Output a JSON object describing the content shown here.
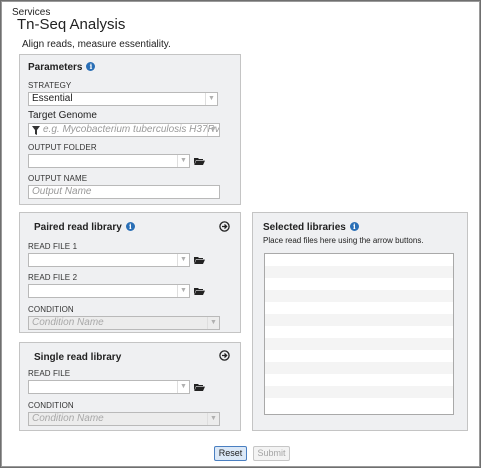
{
  "breadcrumb": "Services",
  "title": "Tn-Seq Analysis",
  "description": "Align reads, measure essentiality.",
  "parameters": {
    "title": "Parameters",
    "strategy_label": "STRATEGY",
    "strategy_value": "Essential",
    "genome_label": "Target Genome",
    "genome_placeholder": "e.g. Mycobacterium tuberculosis H37Rv",
    "output_folder_label": "OUTPUT FOLDER",
    "output_folder_value": "",
    "output_name_label": "OUTPUT NAME",
    "output_name_placeholder": "Output Name"
  },
  "paired": {
    "title": "Paired read library",
    "read1_label": "READ FILE 1",
    "read1_value": "",
    "read2_label": "READ FILE 2",
    "read2_value": "",
    "condition_label": "CONDITION",
    "condition_placeholder": "Condition Name"
  },
  "single": {
    "title": "Single read library",
    "read_label": "READ FILE",
    "read_value": "",
    "condition_label": "CONDITION",
    "condition_placeholder": "Condition Name"
  },
  "selected": {
    "title": "Selected libraries",
    "hint": "Place read files here using the arrow buttons.",
    "rows": [
      "",
      "",
      "",
      "",
      "",
      "",
      "",
      "",
      "",
      "",
      "",
      "",
      ""
    ]
  },
  "buttons": {
    "reset": "Reset",
    "submit": "Submit"
  },
  "colors": {
    "accent": "#2a6fb6",
    "panel_bg": "#eff0f2"
  }
}
